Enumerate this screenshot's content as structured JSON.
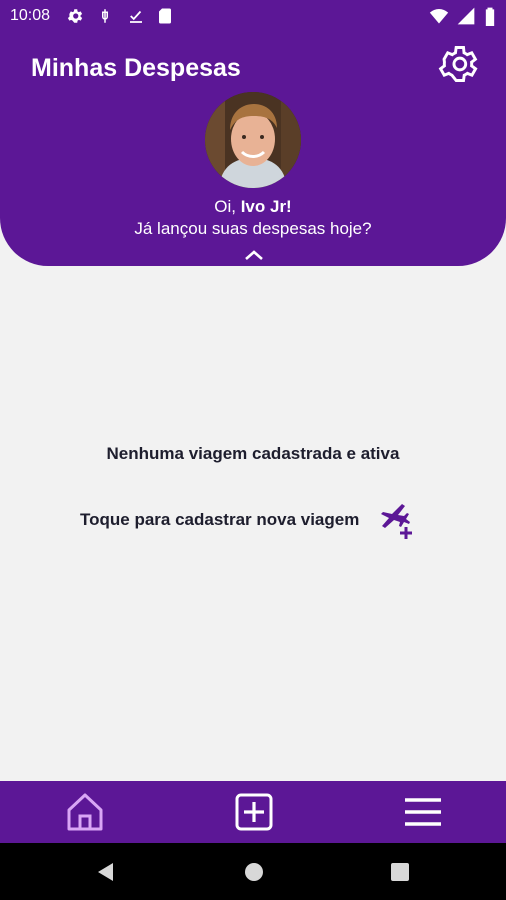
{
  "status_bar": {
    "time": "10:08",
    "left_icons": [
      "gear-icon",
      "usb-icon",
      "download-icon",
      "sd-card-icon"
    ],
    "right_icons": [
      "wifi-icon",
      "signal-icon",
      "battery-icon"
    ]
  },
  "header": {
    "title": "Minhas Despesas",
    "greeting_prefix": "Oi, ",
    "user_name": "Ivo Jr!",
    "subtitle": "Já lançou suas despesas hoje?",
    "background_color": "#5c1796"
  },
  "main": {
    "empty_message": "Nenhuma viagem cadastrada e ativa",
    "cta_label": "Toque para cadastrar nova viagem",
    "cta_icon": "airplane-plus-icon",
    "accent_color": "#5c1796"
  },
  "bottom_nav": {
    "items": [
      {
        "icon": "home-icon",
        "active": true
      },
      {
        "icon": "add-box-icon",
        "active": false
      },
      {
        "icon": "menu-icon",
        "active": false
      }
    ]
  },
  "system_nav": {
    "items": [
      "back-icon",
      "home-circle-icon",
      "recents-icon"
    ]
  }
}
